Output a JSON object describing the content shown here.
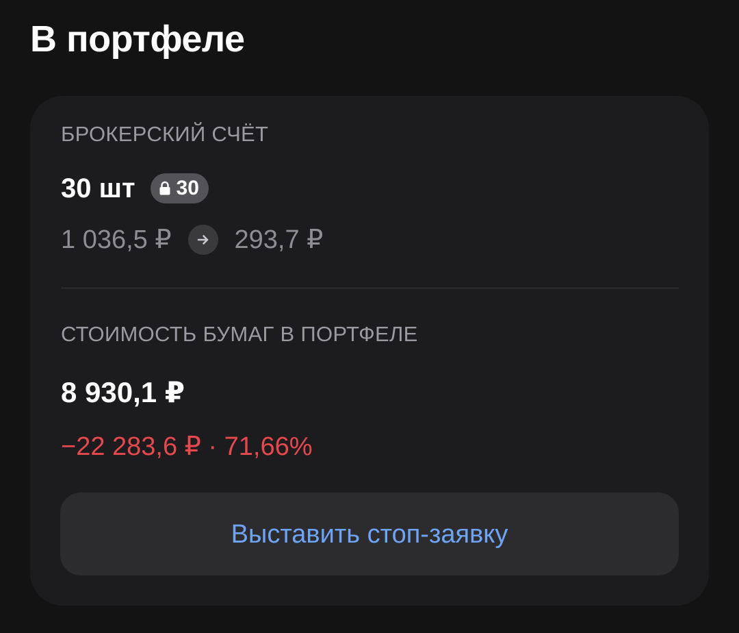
{
  "page_title": "В портфеле",
  "card": {
    "account_label": "БРОКЕРСКИЙ СЧЁТ",
    "quantity": "30 шт",
    "blocked_quantity": "30",
    "blocked_icon": "lock-icon",
    "avg_price": "1 036,5 ₽",
    "arrow_icon": "arrow-right-icon",
    "current_price": "293,7 ₽",
    "value_label": "СТОИМОСТЬ БУМАГ В ПОРТФЕЛЕ",
    "total_value": "8 930,1 ₽",
    "change": "−22 283,6 ₽ · 71,66%",
    "stop_order_button": "Выставить стоп-заявку"
  },
  "colors": {
    "background": "#131314",
    "card": "#1c1c1e",
    "negative": "#e5484d",
    "accent": "#6ea4f5"
  }
}
